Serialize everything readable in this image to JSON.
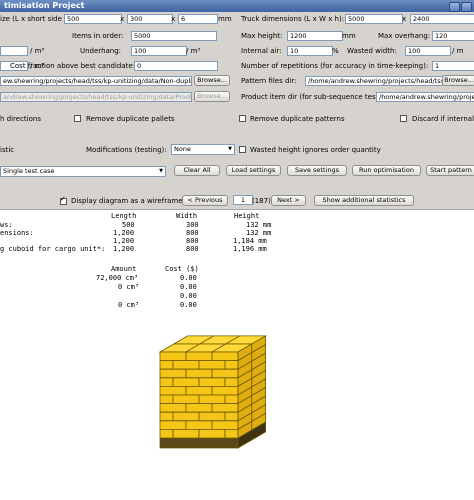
{
  "window": {
    "title": "timisation Project"
  },
  "row1": {
    "label": "ize (L x short side x h):",
    "v1": "500",
    "v2": "300",
    "v3": "6",
    "unit": "mm",
    "truck_label": "Truck dimensions (L x W x h):",
    "truck_v1": "5000",
    "truck_v2": "2400"
  },
  "row2": {
    "label": "Items in order:",
    "value": "5000",
    "maxh_label": "Max height:",
    "maxh_value": "1200",
    "maxh_unit": "mm",
    "maxo_label": "Max overhang:",
    "maxo_value": "120"
  },
  "row3": {
    "unit1": "/ m³",
    "underhang_label": "Underhang:",
    "underhang_value": "100",
    "unit2": "/ m³",
    "air_label": "Internal air:",
    "air_value": "10",
    "air_unit": "%",
    "wasted_label": "Wasted width:",
    "wasted_value": "100",
    "wasted_unit": "/ m"
  },
  "row4": {
    "unit1": "/ m³",
    "cost_label": "Cost fraction above best candidate:",
    "cost_value": "0",
    "reps_label": "Number of repetitions (for accuracy in time-keeping):",
    "reps_value": "1"
  },
  "row5": {
    "path": "ew.shewring/projects/head/tss/kp-unitizing/data/Non-dupli",
    "browse": "Browse...",
    "pattern_label": "Pattern files dir:",
    "pattern_path": "/home/andrew.shewring/projects/head/tss/kp-unitizing/data/",
    "browse2": "Browse..."
  },
  "row6": {
    "path": "andrew.shewring/projects/head/tss/kp-unitizing/data/Produc",
    "browse": "Browse...",
    "product_label": "Product item dir (for sub-sequence test):",
    "product_path": "/home/andrew.shewring/projects/head/tss/kp-unitizing/data/"
  },
  "checks": {
    "directions": "h directions",
    "remove_pallets": "Remove duplicate pallets",
    "remove_patterns": "Remove duplicate patterns",
    "discard": "Discard if internal"
  },
  "row8": {
    "left": "istic",
    "mod_label": "Modifications (testing):",
    "mod_value": "None",
    "wasted_height": "Wasted height ignores order quantity"
  },
  "row9": {
    "test_case": "Single test case",
    "clear_all": "Clear All",
    "load_settings": "Load settings",
    "save_settings": "Save settings",
    "run": "Run optimisation",
    "start_pattern": "Start pattern"
  },
  "row10": {
    "wireframe": "Display diagram as a wireframe",
    "previous": "< Previous",
    "page": "1",
    "total": "(187)",
    "next": "Next >",
    "stats": "Show additional statistics"
  },
  "results": {
    "headers": {
      "length": "Length",
      "width": "Width",
      "height": "Height"
    },
    "rows": [
      {
        "label": "ws:",
        "length": "500",
        "width": "300",
        "height": "132 mm"
      },
      {
        "label": "ensions:",
        "length": "1,200",
        "width": "800",
        "height": "132 mm"
      },
      {
        "label": "",
        "length": "1,200",
        "width": "800",
        "height": "1,184 mm"
      },
      {
        "label": "g cuboid for cargo unit*:",
        "length": "1,200",
        "width": "800",
        "height": "1,196 mm"
      }
    ],
    "cost_headers": {
      "amount": "Amount",
      "cost": "Cost ($)"
    },
    "cost_rows": [
      {
        "amount": "72,000 cm³",
        "cost": "0.00"
      },
      {
        "amount": "0 cm³",
        "cost": "0.00"
      },
      {
        "amount": "",
        "cost": "0.00"
      },
      {
        "amount": "0 cm³",
        "cost": "0.00"
      }
    ]
  },
  "diagram": {
    "box_color": "#f5c518",
    "edge_color": "#6b5a00",
    "pallet_color": "#5a4a1a"
  }
}
